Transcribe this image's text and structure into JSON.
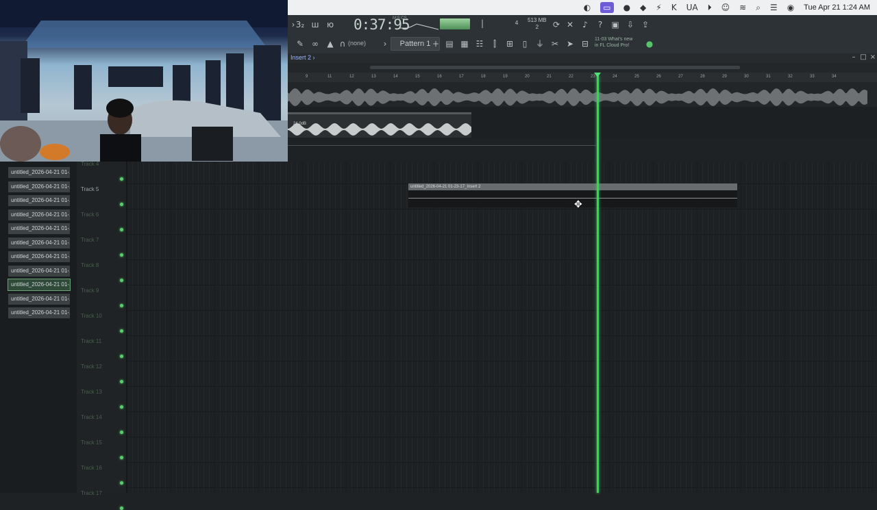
{
  "menubar": {
    "icons": [
      "ac-icon",
      "screen-record-icon",
      "ua-logo-icon",
      "ilok-icon",
      "lightning-icon",
      "kontakt-icon",
      "ua-text",
      "play-circle-icon",
      "user-icon",
      "wifi-icon",
      "search-icon",
      "control-center-icon",
      "siri-icon"
    ],
    "ua_text": "UA",
    "clock": "Tue Apr 21  1:24 AM"
  },
  "toolbar": {
    "time": "0:37:95",
    "time_unit": "M:S:CS",
    "cpu_mem": "513 MB",
    "cpu_voices": "2",
    "pattern_label": "Pattern 1",
    "snap_label": "(none)",
    "channel_num": "4",
    "news_line1": "11-03  What's new",
    "news_line2": "in FL Cloud Pro!",
    "colors": {
      "accent": "#37d45a",
      "meter": "#7fbf84"
    }
  },
  "playlist": {
    "breadcrumb": "Insert 2 ›",
    "bar_numbers": [
      "9",
      "11",
      "12",
      "13",
      "14",
      "15",
      "16",
      "17",
      "18",
      "19",
      "20",
      "21",
      "22",
      "23",
      "24",
      "25",
      "26",
      "27",
      "28",
      "29",
      "30",
      "31",
      "32",
      "33",
      "34"
    ],
    "top_clip_label": "24.0dB",
    "lower_clip_label": "untitled_2026-04-21 01-23-17_Insert 2",
    "tracks": [
      "Track 4",
      "Track 5",
      "Track 6",
      "Track 7",
      "Track 8",
      "Track 9",
      "Track 10",
      "Track 11",
      "Track 12",
      "Track 13",
      "Track 14",
      "Track 15",
      "Track 16",
      "Track 17"
    ]
  },
  "browser": {
    "files": [
      "untitled_2026-04-21 01-...",
      "untitled_2026-04-21 01-...",
      "untitled_2026-04-21 01-...",
      "untitled_2026-04-21 01-...",
      "untitled_2026-04-21 01-...",
      "untitled_2026-04-21 01-...",
      "untitled_2026-04-21 01-...",
      "untitled_2026-04-21 01-...",
      "untitled_2026-04-21 01-...",
      "untitled_2026-04-21 01-...",
      "untitled_2026-04-21 01-..."
    ]
  }
}
